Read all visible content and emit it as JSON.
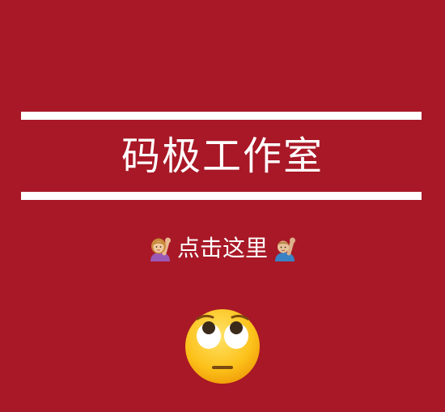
{
  "colors": {
    "background": "#a81826",
    "rule": "#ffffff",
    "text": "#ffffff"
  },
  "header": {
    "title": "码极工作室"
  },
  "cta": {
    "label": "点击这里",
    "left_icon": "person-raising-hand-emoji",
    "right_icon": "person-raising-hand-emoji"
  },
  "footer": {
    "icon": "face-with-rolling-eyes-emoji"
  }
}
